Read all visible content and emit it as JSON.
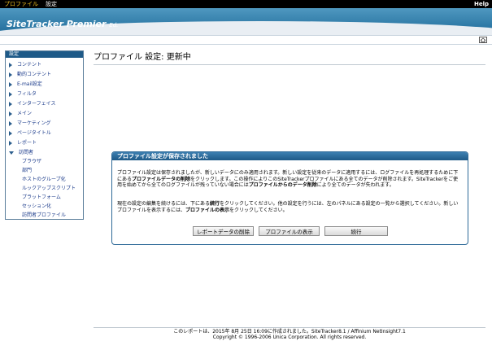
{
  "menu": {
    "profile": "プロファイル",
    "settings": "設定",
    "help": "Help"
  },
  "banner": {
    "brand": "SiteTracker Premier",
    "edition": "Ed."
  },
  "sidebar": {
    "header": "設定",
    "items": [
      "コンテント",
      "動的コンテント",
      "E-mail設定",
      "フィルタ",
      "インターフェイス",
      "メイン",
      "マーケティング",
      "ページタイトル",
      "レポート",
      "訪問者"
    ],
    "subitems": [
      "ブラウザ",
      "部門",
      "ホストのグループ化",
      "ルックアップスクリプト",
      "プラットフォーム",
      "セッション化",
      "訪問者プロファイル"
    ]
  },
  "page": {
    "title": "プロファイル 設定: 更新中"
  },
  "dialog": {
    "title": "プロファイル設定が保存されました",
    "p1a": "プロファイル設定は保存されましたが、新しいデータにのみ適用されます。新しい設定を従来のデータに適用するには、ログファイルを再処理するために下にある",
    "p1b": "プロファイルデータの削除",
    "p1c": "をクリックします。この操作によりこのSiteTrackerプロファイルにある全てのデータが削除されます。SiteTrackerをご使用を始めてから全てのログファイルが残っていない場合には",
    "p1d": "プロファイルからのデータ削除",
    "p1e": "により全てのデータが失われます。",
    "p2a": "現在の設定の編集を続けるには、下にある",
    "p2b": "続行",
    "p2c": "をクリックしてください。他の設定を行うには、左のパネルにある設定の一覧から選択してください。新しいプロファイルを表示するには、",
    "p2d": "プロファイルの表示",
    "p2e": "をクリックしてください。",
    "buttons": {
      "delete": "レポートデータの削除",
      "view": "プロファイルの表示",
      "continue": "続行"
    }
  },
  "footer": {
    "line1": "このレポートは、2015年 8月 25日 16:09に作成されました。SiteTracker8.1 / Affinium NetInsight7.1",
    "line2": "Copyright © 1996-2006 Unica Corporation. All rights reserved."
  }
}
